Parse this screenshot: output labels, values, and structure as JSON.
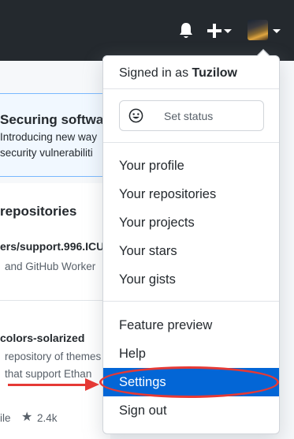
{
  "header": {
    "icons": [
      "bell-icon",
      "plus-icon",
      "avatar"
    ]
  },
  "background": {
    "banner_title": "Securing softwar",
    "banner_line1": "Introducing new way",
    "banner_line2": "security vulnerabiliti",
    "repositories_heading": "repositories",
    "repo1_name": "ers/support.996.ICU",
    "repo1_desc": "and GitHub Worker",
    "repo2_name": "colors-solarized",
    "repo2_desc1": "repository of themes",
    "repo2_desc2": "that support Ethan",
    "repo2_lang": "ile",
    "repo2_stars": "2.4k"
  },
  "menu": {
    "signed_in_prefix": "Signed in as ",
    "username": "Tuzilow",
    "set_status": "Set status",
    "group1": [
      "Your profile",
      "Your repositories",
      "Your projects",
      "Your stars",
      "Your gists"
    ],
    "group2": [
      "Feature preview",
      "Help",
      "Settings",
      "Sign out"
    ],
    "selected": "Settings"
  },
  "colors": {
    "header_bg": "#24292e",
    "highlight": "#0366d6",
    "annotation": "#e53935"
  }
}
